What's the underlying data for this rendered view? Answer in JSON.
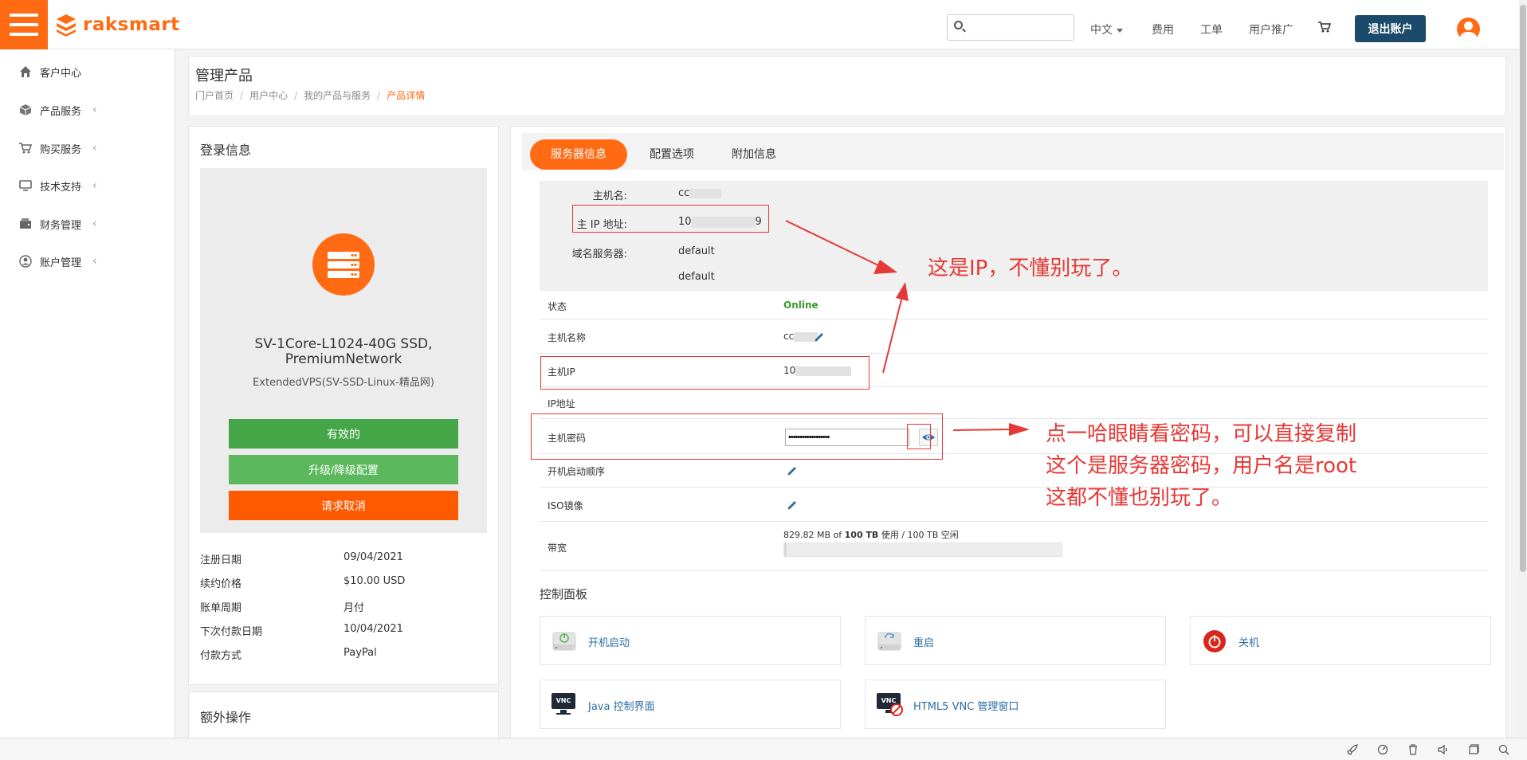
{
  "brand": {
    "name": "raksmart"
  },
  "colors": {
    "accent": "#ff6a13",
    "navy": "#1c4a6b",
    "green": "#44a647",
    "green_light": "#5cb85c",
    "cancel": "#ff5a00",
    "annotation": "#e53935",
    "link": "#2e6da4",
    "online": "#3a9a2e"
  },
  "topnav": {
    "language": "中文",
    "billing": "费用",
    "tickets": "工单",
    "affiliate": "用户推广",
    "logout": "退出账户"
  },
  "search": {
    "value": "",
    "placeholder": ""
  },
  "sidebar": {
    "items": [
      {
        "label": "客户中心",
        "icon": "home-icon"
      },
      {
        "label": "产品服务",
        "icon": "cube-icon"
      },
      {
        "label": "购买服务",
        "icon": "cart-icon"
      },
      {
        "label": "技术支持",
        "icon": "monitor-icon"
      },
      {
        "label": "财务管理",
        "icon": "wallet-icon"
      },
      {
        "label": "账户管理",
        "icon": "user-circle-icon"
      }
    ],
    "caret": "‹"
  },
  "page": {
    "title": "管理产品",
    "breadcrumb": [
      "门户首页",
      "用户中心",
      "我的产品与服务",
      "产品详情"
    ]
  },
  "login_info": {
    "title": "登录信息",
    "product_name_line1": "SV-1Core-L1024-40G SSD,",
    "product_name_line2": "PremiumNetwork",
    "product_group": "ExtendedVPS(SV-SSD-Linux-精品网)",
    "btn_active": "有效的",
    "btn_upgrade": "升级/降级配置",
    "btn_cancel": "请求取消",
    "rows": [
      {
        "label": "注册日期",
        "value": "09/04/2021"
      },
      {
        "label": "续约价格",
        "value": "$10.00 USD"
      },
      {
        "label": "账单周期",
        "value": "月付"
      },
      {
        "label": "下次付款日期",
        "value": "10/04/2021"
      },
      {
        "label": "付款方式",
        "value": "PayPal"
      }
    ]
  },
  "extra_ops": {
    "title": "额外操作"
  },
  "tabs": [
    "服务器信息",
    "配置选项",
    "附加信息"
  ],
  "host_info": {
    "hostname_label": "主机名:",
    "hostname_value": "cc",
    "ip_label": "主 IP 地址:",
    "ip_value_prefix": "10",
    "ip_value_suffix": "9",
    "ns_label": "域名服务器:",
    "ns1": "default",
    "ns2": "default"
  },
  "details": {
    "status_label": "状态",
    "status_value": "Online",
    "hostname_label": "主机名称",
    "hostname_value": "cc",
    "main_ip_label": "主机IP",
    "main_ip_value": "10",
    "ip_list_label": "IP地址",
    "password_label": "主机密码",
    "password_value": "••••••••••••••••••",
    "boot_order_label": "开机启动顺序",
    "iso_label": "ISO镜像",
    "bandwidth_label": "带宽",
    "bandwidth_used": "829.82 MB",
    "bandwidth_of": "of",
    "bandwidth_limit": "100 TB",
    "bandwidth_used_word": "使用 /",
    "bandwidth_free": "100 TB 空闲",
    "bandwidth_fraction": 0.01
  },
  "control_panel": {
    "title": "控制面板",
    "power_on": "开机启动",
    "reboot": "重启",
    "shutdown": "关机",
    "java_console": "Java 控制界面",
    "html5_vnc": "HTML5 VNC 管理窗口",
    "vnc_badge": "VNC"
  },
  "annotations": {
    "ip_note": "这是IP，不懂别玩了。",
    "pwd_note_line1": "点一哈眼睛看密码，可以直接复制",
    "pwd_note_line2": "这个是服务器密码，用户名是root",
    "pwd_note_line3": "这都不懂也别玩了。"
  }
}
